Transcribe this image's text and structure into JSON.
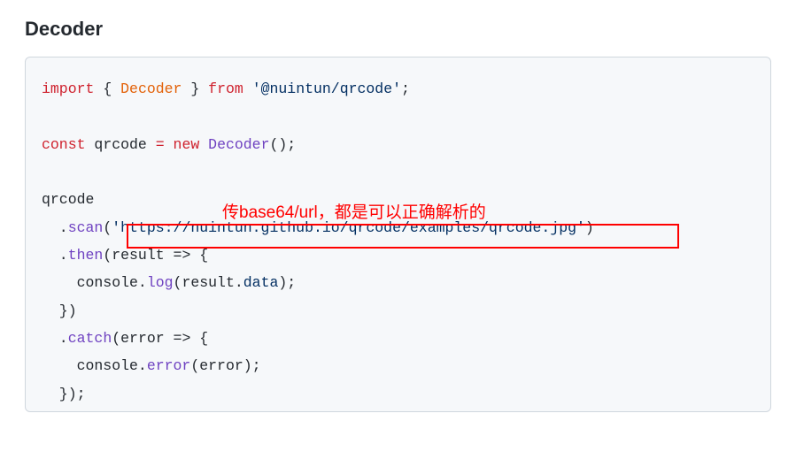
{
  "heading": "Decoder",
  "annotation": "传base64/url，都是可以正确解析的",
  "code": {
    "l1_import": "import",
    "l1_lbrace": " { ",
    "l1_decoder": "Decoder",
    "l1_rbrace": " } ",
    "l1_from": "from",
    "l1_sp": " ",
    "l1_pkg": "'@nuintun/qrcode'",
    "l1_semi": ";",
    "l3_const": "const",
    "l3_sp1": " qrcode ",
    "l3_eq": "=",
    "l3_sp2": " ",
    "l3_new": "new",
    "l3_sp3": " ",
    "l3_cls": "Decoder",
    "l3_paren": "();",
    "l5_qrcode": "qrcode",
    "l6_indent": "  .",
    "l6_scan": "scan",
    "l6_op": "(",
    "l6_url": "'https://nuintun.github.io/qrcode/examples/qrcode.jpg'",
    "l6_cp": ")",
    "l7_indent": "  .",
    "l7_then": "then",
    "l7_rest": "(result => {",
    "l8_indent": "    console.",
    "l8_log": "log",
    "l8_op": "(result.",
    "l8_data": "data",
    "l8_cp": ");",
    "l9": "  })",
    "l10_indent": "  .",
    "l10_catch": "catch",
    "l10_rest": "(error => {",
    "l11_indent": "    console.",
    "l11_error": "error",
    "l11_rest": "(error);",
    "l12": "  });"
  }
}
